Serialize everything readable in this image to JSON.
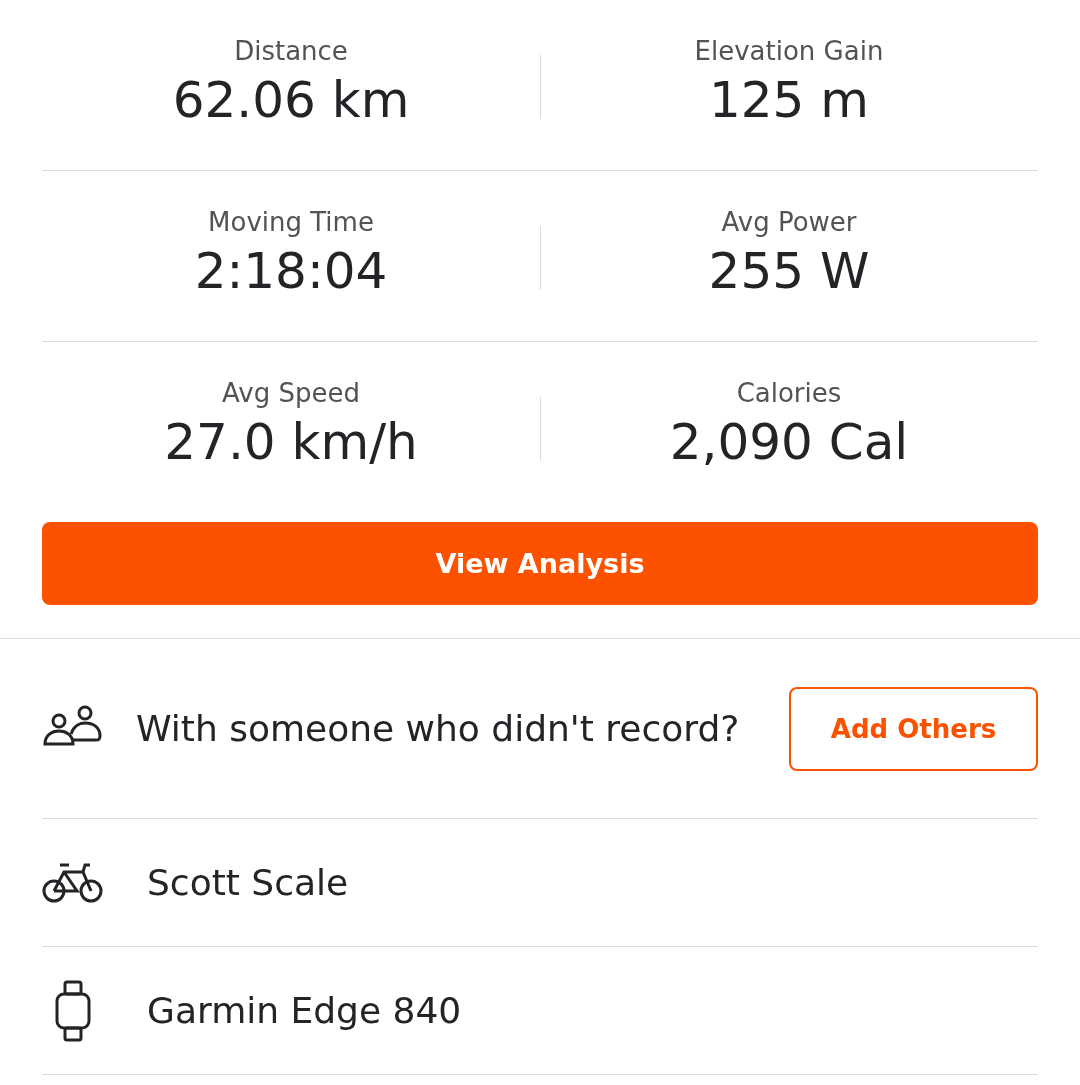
{
  "stats": [
    {
      "label": "Distance",
      "value": "62.06 km"
    },
    {
      "label": "Elevation Gain",
      "value": "125 m"
    },
    {
      "label": "Moving Time",
      "value": "2:18:04"
    },
    {
      "label": "Avg Power",
      "value": "255 W"
    },
    {
      "label": "Avg Speed",
      "value": "27.0 km/h"
    },
    {
      "label": "Calories",
      "value": "2,090 Cal"
    }
  ],
  "analysis_button": "View Analysis",
  "companions": {
    "text": "With someone who didn't record?",
    "button": "Add Others"
  },
  "details": [
    {
      "kind": "bike",
      "label": "Scott Scale"
    },
    {
      "kind": "device",
      "label": "Garmin Edge 840"
    }
  ]
}
